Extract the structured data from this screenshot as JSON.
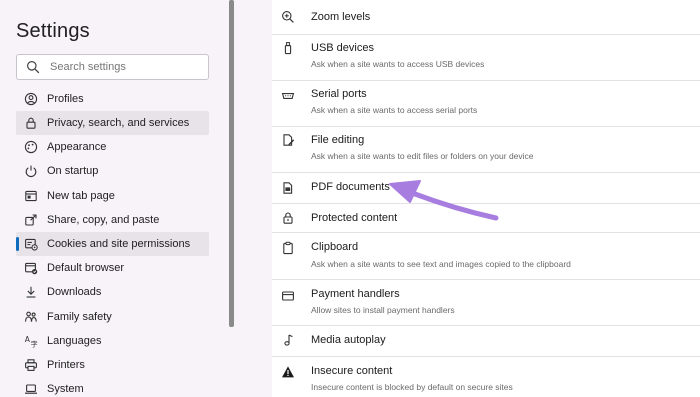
{
  "sidebar": {
    "title": "Settings",
    "search": {
      "placeholder": "Search settings"
    },
    "items": [
      {
        "label": "Profiles",
        "icon": "profile-icon"
      },
      {
        "label": "Privacy, search, and services",
        "icon": "lock-icon"
      },
      {
        "label": "Appearance",
        "icon": "appearance-icon"
      },
      {
        "label": "On startup",
        "icon": "power-icon"
      },
      {
        "label": "New tab page",
        "icon": "new-tab-icon"
      },
      {
        "label": "Share, copy, and paste",
        "icon": "share-icon"
      },
      {
        "label": "Cookies and site permissions",
        "icon": "cookies-icon",
        "active": true
      },
      {
        "label": "Default browser",
        "icon": "browser-icon"
      },
      {
        "label": "Downloads",
        "icon": "download-icon"
      },
      {
        "label": "Family safety",
        "icon": "family-icon"
      },
      {
        "label": "Languages",
        "icon": "language-icon"
      },
      {
        "label": "Printers",
        "icon": "printer-icon"
      },
      {
        "label": "System",
        "icon": "laptop-icon"
      }
    ]
  },
  "permissions": [
    {
      "title": "Zoom levels",
      "desc": "",
      "icon": "zoom-icon"
    },
    {
      "title": "USB devices",
      "desc": "Ask when a site wants to access USB devices",
      "icon": "usb-icon"
    },
    {
      "title": "Serial ports",
      "desc": "Ask when a site wants to access serial ports",
      "icon": "serial-port-icon"
    },
    {
      "title": "File editing",
      "desc": "Ask when a site wants to edit files or folders on your device",
      "icon": "file-edit-icon"
    },
    {
      "title": "PDF documents",
      "desc": "",
      "icon": "pdf-icon"
    },
    {
      "title": "Protected content",
      "desc": "",
      "icon": "protected-content-icon"
    },
    {
      "title": "Clipboard",
      "desc": "Ask when a site wants to see text and images copied to the clipboard",
      "icon": "clipboard-icon"
    },
    {
      "title": "Payment handlers",
      "desc": "Allow sites to install payment handlers",
      "icon": "payment-icon"
    },
    {
      "title": "Media autoplay",
      "desc": "",
      "icon": "music-note-icon"
    },
    {
      "title": "Insecure content",
      "desc": "Insecure content is blocked by default on secure sites",
      "icon": "warning-icon"
    }
  ],
  "colors": {
    "accent": "#0f6cbd",
    "arrow": "#a77de0",
    "background": "#f7f3f8",
    "panel": "#ffffff"
  }
}
